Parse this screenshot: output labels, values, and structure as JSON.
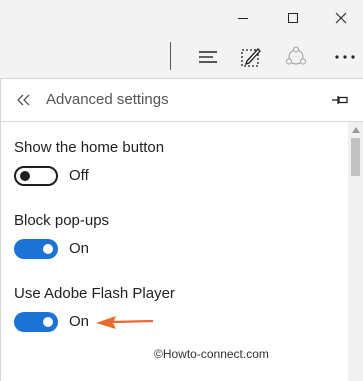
{
  "window": {
    "controls": [
      {
        "name": "minimize",
        "icon": "minimize-icon"
      },
      {
        "name": "maximize",
        "icon": "maximize-icon"
      },
      {
        "name": "close",
        "icon": "close-icon"
      }
    ]
  },
  "toolbar": {
    "icons": [
      "hub-icon",
      "web-note-icon",
      "share-icon",
      "more-icon"
    ]
  },
  "panel": {
    "title": "Advanced settings",
    "back_icon": "double-chevron-left-icon",
    "pin_icon": "pin-icon"
  },
  "settings": [
    {
      "label": "Show the home button",
      "state": "Off",
      "on": false
    },
    {
      "label": "Block pop-ups",
      "state": "On",
      "on": true
    },
    {
      "label": "Use Adobe Flash Player",
      "state": "On",
      "on": true
    }
  ],
  "colors": {
    "toggle_on": "#1b73d6",
    "arrow": "#ec6a2d",
    "chrome_bg": "#f3f3f3"
  },
  "watermark": "©Howto-connect.com"
}
